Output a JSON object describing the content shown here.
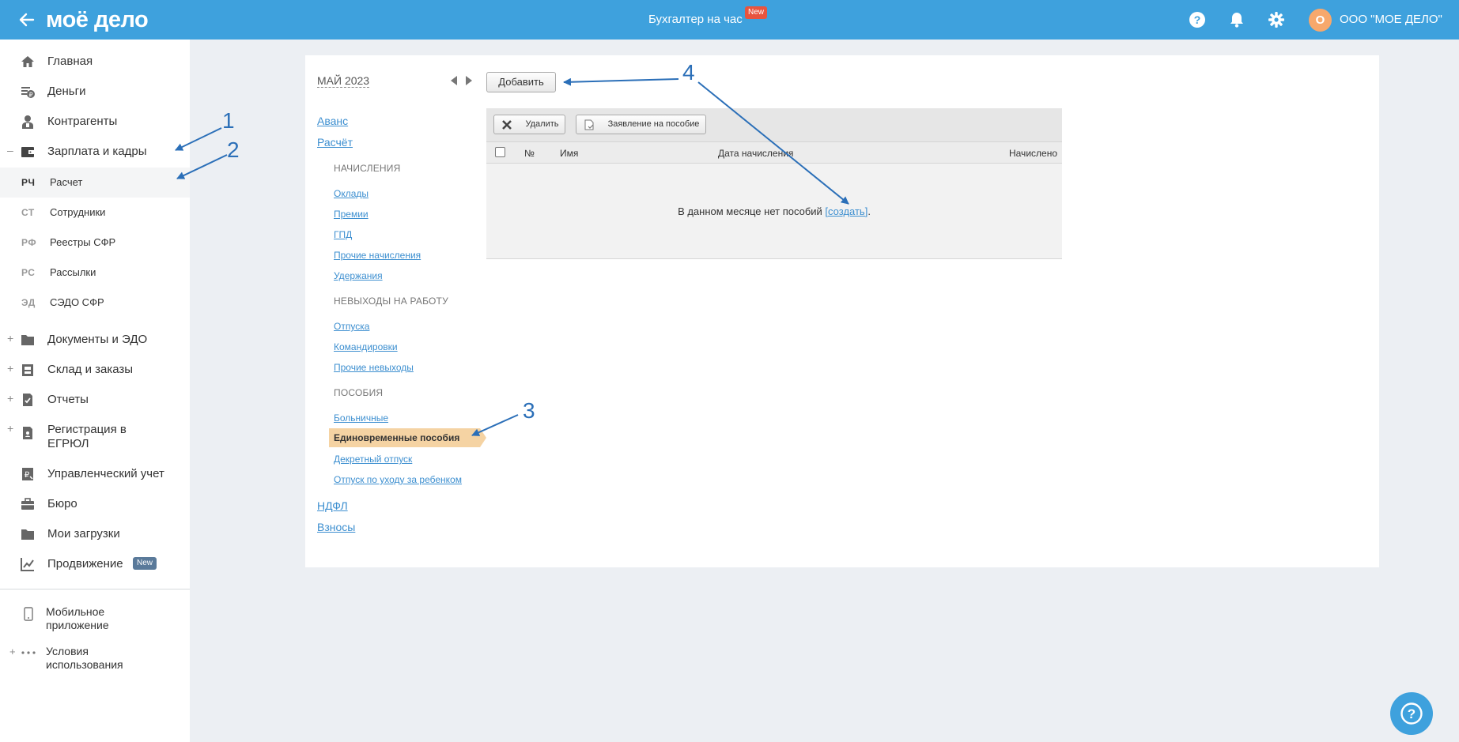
{
  "topbar": {
    "logo": "моё дело",
    "center_link": "Бухгалтер на час",
    "new_badge": "New",
    "company": "ООО \"МОЕ ДЕЛО\"",
    "avatar_letter": "О",
    "icons": [
      "question-icon",
      "bell-icon",
      "gear-icon"
    ]
  },
  "sidebar": {
    "items": [
      {
        "label": "Главная",
        "icon": "home-icon"
      },
      {
        "label": "Деньги",
        "icon": "money-icon"
      },
      {
        "label": "Контрагенты",
        "icon": "contractors-icon"
      },
      {
        "label": "Зарплата и кадры",
        "icon": "wallet-icon",
        "toggle": "–"
      },
      {
        "label": "Документы и ЭДО",
        "icon": "folder-icon",
        "toggle": "+"
      },
      {
        "label": "Склад и заказы",
        "icon": "warehouse-icon",
        "toggle": "+"
      },
      {
        "label": "Отчеты",
        "icon": "report-icon",
        "toggle": "+"
      },
      {
        "label": "Регистрация в ЕГРЮЛ",
        "icon": "registration-icon",
        "toggle": "+"
      },
      {
        "label": "Управленческий учет",
        "icon": "management-icon"
      },
      {
        "label": "Бюро",
        "icon": "briefcase-icon"
      },
      {
        "label": "Мои загрузки",
        "icon": "downloads-folder-icon"
      },
      {
        "label": "Продвижение",
        "icon": "chart-icon",
        "badge": "New"
      }
    ],
    "sub_items": [
      {
        "abbr": "РЧ",
        "label": "Расчет"
      },
      {
        "abbr": "СТ",
        "label": "Сотрудники"
      },
      {
        "abbr": "РФ",
        "label": "Реестры СФР"
      },
      {
        "abbr": "РС",
        "label": "Рассылки"
      },
      {
        "abbr": "ЭД",
        "label": "СЭДО СФР"
      }
    ],
    "bottom": [
      {
        "label": "Мобильное приложение",
        "icon": "mobile-icon"
      },
      {
        "label": "Условия использования",
        "icon": "more-icon",
        "toggle": "+"
      }
    ]
  },
  "main": {
    "month": "МАЙ 2023",
    "add_button": "Добавить",
    "nav": {
      "avans": "Аванс",
      "raschet": "Расчёт",
      "section_accruals": "НАЧИСЛЕНИЯ",
      "accruals": [
        "Оклады",
        "Премии",
        "ГПД",
        "Прочие начисления",
        "Удержания"
      ],
      "section_absences": "НЕВЫХОДЫ НА РАБОТУ",
      "absences": [
        "Отпуска",
        "Командировки",
        "Прочие невыходы"
      ],
      "section_benefits": "ПОСОБИЯ",
      "benefit_sick": "Больничные",
      "benefit_selected": "Единовременные пособия",
      "benefit_maternity": "Декретный отпуск",
      "benefit_childcare": "Отпуск по уходу за ребенком",
      "ndfl": "НДФЛ",
      "contributions": "Взносы"
    },
    "toolbar": {
      "delete": "Удалить",
      "application": "Заявление на пособие"
    },
    "table": {
      "columns": [
        "№",
        "Имя",
        "Дата начисления",
        "Начислено"
      ],
      "empty_text": "В данном месяце нет пособий ",
      "empty_link": "[создать]",
      "empty_end": "."
    }
  },
  "annotations": [
    "1",
    "2",
    "3",
    "4"
  ],
  "colors": {
    "topbar": "#3ea1dd",
    "link": "#3d8fd0",
    "selected": "#f5d3a3",
    "annotation": "#2b6fb8",
    "badge_red": "#e8543f"
  }
}
